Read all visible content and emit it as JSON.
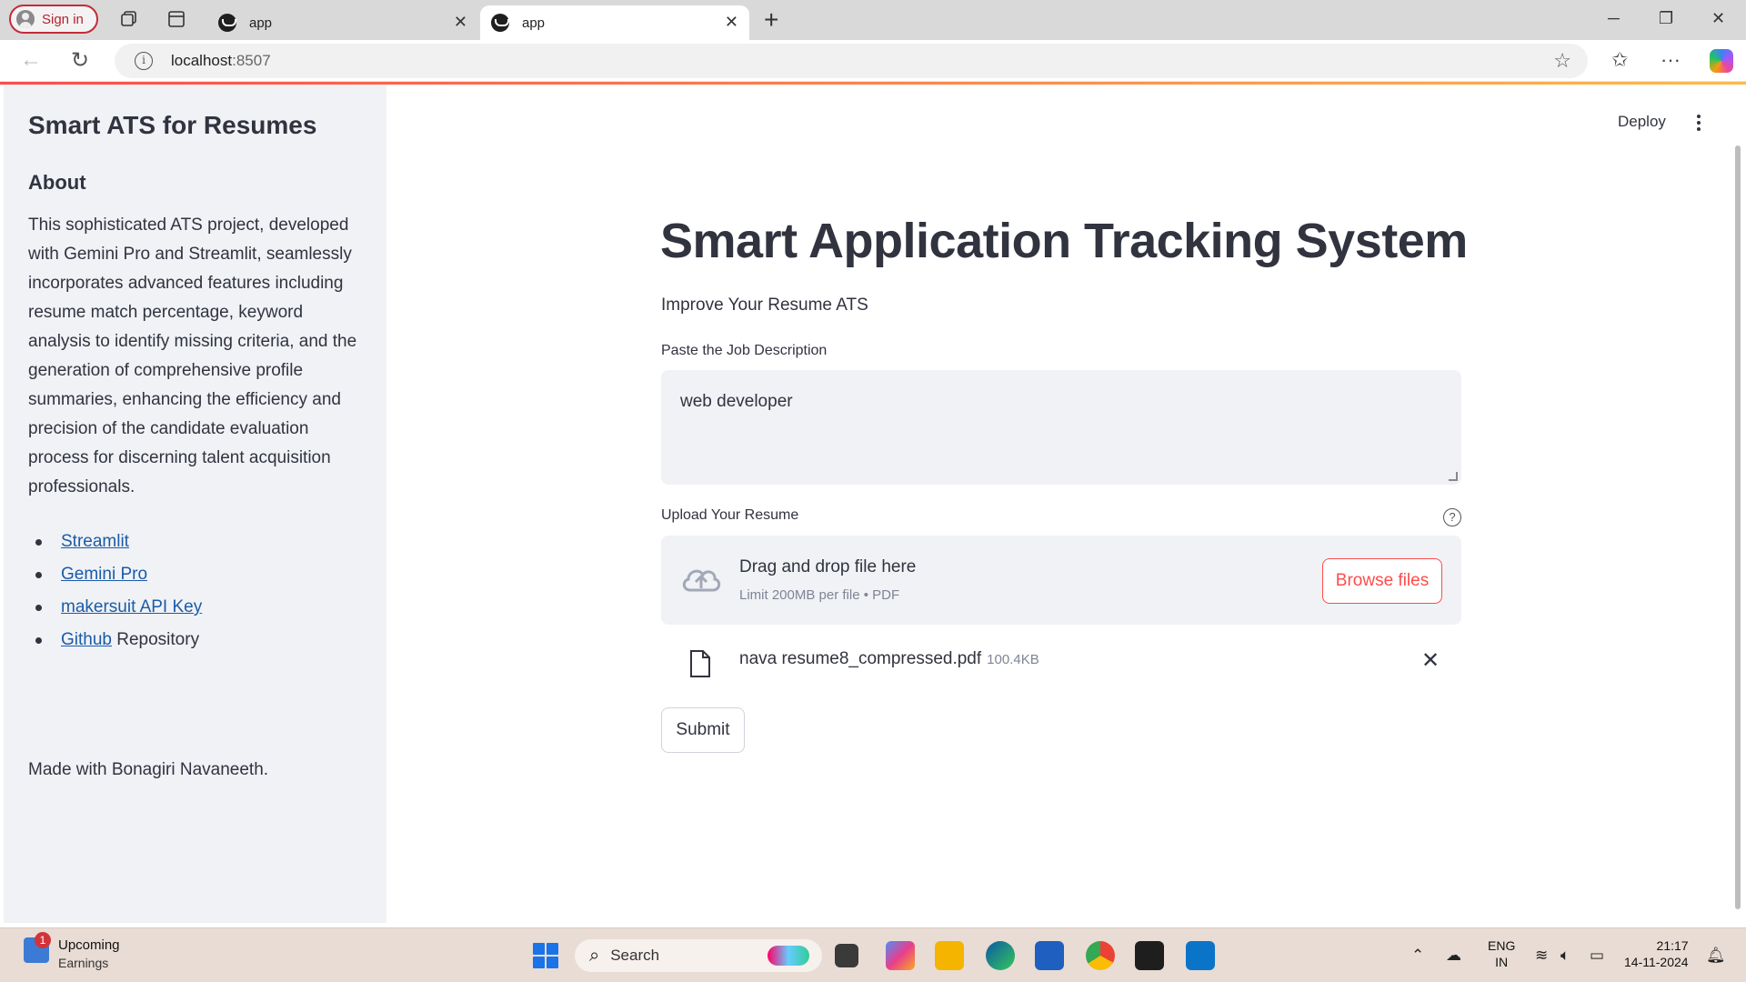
{
  "browser": {
    "signin_label": "Sign in",
    "tabs": [
      {
        "title": "app",
        "active": false
      },
      {
        "title": "app",
        "active": true
      }
    ],
    "url_host": "localhost",
    "url_port": ":8507"
  },
  "streamlit_header": {
    "deploy_label": "Deploy"
  },
  "sidebar": {
    "title": "Smart ATS for Resumes",
    "about_heading": "About",
    "description": "This sophisticated ATS project, developed with Gemini Pro and Streamlit, seamlessly incorporates advanced features including resume match percentage, keyword analysis to identify missing criteria, and the generation of comprehensive profile summaries, enhancing the efficiency and precision of the candidate evaluation process for discerning talent acquisition professionals.",
    "links": [
      {
        "link_text": "Streamlit",
        "suffix": ""
      },
      {
        "link_text": "Gemini Pro",
        "suffix": ""
      },
      {
        "link_text": "makersuit API Key",
        "suffix": ""
      },
      {
        "link_text": "Github",
        "suffix": " Repository"
      }
    ],
    "footer": "Made with Bonagiri Navaneeth."
  },
  "main": {
    "title": "Smart Application Tracking System",
    "subtitle": "Improve Your Resume ATS",
    "jd_label": "Paste the Job Description",
    "jd_value": "web developer",
    "upload_label": "Upload Your Resume",
    "help_icon_glyph": "?",
    "dropzone_title": "Drag and drop file here",
    "dropzone_limit": "Limit 200MB per file • PDF",
    "browse_label": "Browse files",
    "uploaded_file": {
      "name": "nava resume8_compressed.pdf",
      "size": "100.4KB"
    },
    "submit_label": "Submit"
  },
  "taskbar": {
    "widget_badge": "1",
    "widget_title": "Upcoming",
    "widget_subtitle": "Earnings",
    "search_label": "Search",
    "lang_line1": "ENG",
    "lang_line2": "IN",
    "time": "21:17",
    "date": "14-11-2024"
  },
  "colors": {
    "accent": "#ff4b4b",
    "sidebar_bg": "#f0f2f6",
    "text": "#31333f",
    "link": "#1c5ba8"
  }
}
